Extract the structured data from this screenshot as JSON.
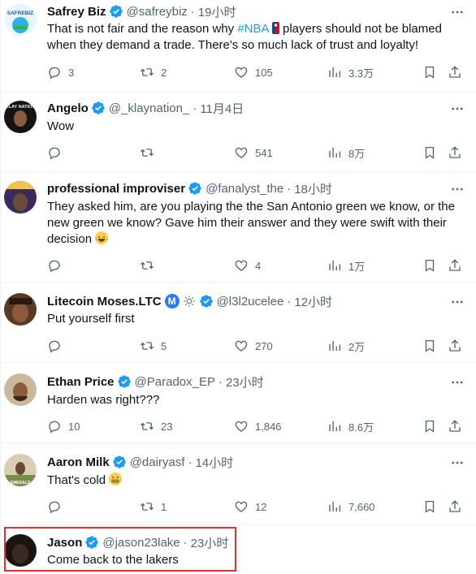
{
  "tweets": [
    {
      "name": "Safrey Biz",
      "handle": "@safreybiz",
      "time": "19小时",
      "text_before": "That is not fair and the reason why ",
      "hashtag": "#NBA",
      "text_after": "  players should not be blamed when they demand a trade. There's so much lack of trust and loyalty!",
      "avatar_label": "SAFREBIZ",
      "replies": "3",
      "retweets": "2",
      "likes": "105",
      "views": "3.3万"
    },
    {
      "name": "Angelo",
      "handle": "@_klaynation_",
      "time": "11月4日",
      "text": "Wow",
      "avatar_label": "KLAY NATION",
      "replies": "",
      "retweets": "",
      "likes": "541",
      "views": "8万"
    },
    {
      "name": "professional improviser",
      "handle": "@fanalyst_the",
      "time": "18小时",
      "text": "They asked him, are you playing the the San Antonio green we know, or the new green we know? Gave him their answer and they were swift with their decision",
      "replies": "",
      "retweets": "",
      "likes": "4",
      "views": "1万"
    },
    {
      "name": "Litecoin Moses.LTC",
      "badge_letter": "M",
      "handle": "@l3l2ucelee",
      "time": "12小时",
      "text": "Put yourself first",
      "replies": "",
      "retweets": "5",
      "likes": "270",
      "views": "2万"
    },
    {
      "name": "Ethan Price",
      "handle": "@Paradox_EP",
      "time": "23小时",
      "text": "Harden was right???",
      "replies": "10",
      "retweets": "23",
      "likes": "1,846",
      "views": "8.6万"
    },
    {
      "name": "Aaron Milk",
      "handle": "@dairyasf",
      "time": "14小时",
      "text": "That's cold",
      "avatar_label": "EMERALD",
      "replies": "",
      "retweets": "1",
      "likes": "12",
      "views": "7,660"
    },
    {
      "name": "Jason",
      "handle": "@jason23lake",
      "time": "23小时",
      "text": "Come back to the lakers"
    }
  ],
  "separator": "·",
  "colors": {
    "accent": "#1d9bf0",
    "muted": "#536471",
    "highlight": "#e0312f"
  }
}
